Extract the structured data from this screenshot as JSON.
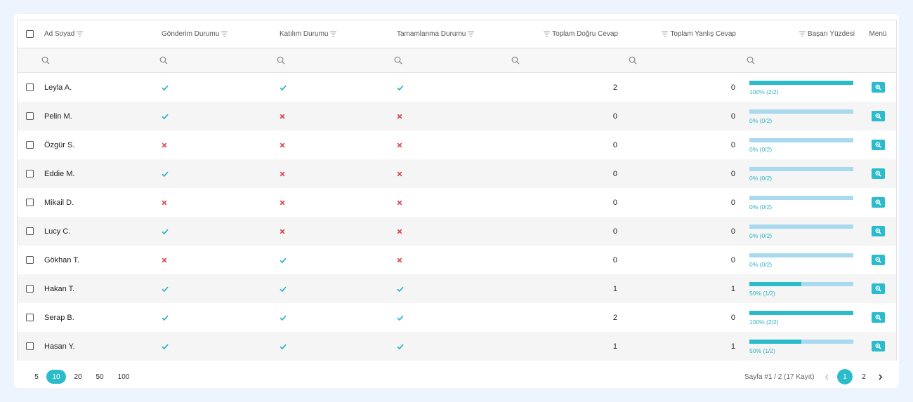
{
  "colors": {
    "accent": "#2bbccb",
    "bar_bg": "#a9d9ef",
    "check": "#2bb3c9",
    "cross": "#d9414b"
  },
  "columns": {
    "name": "Ad Soyad",
    "gonderim": "Gönderim Durumu",
    "katilim": "Katılım Durumu",
    "tamamlanma": "Tamamlanma Durumu",
    "dogru": "Toplam Doğru Cevap",
    "yanlis": "Toplam Yanlış Cevap",
    "basari": "Başarı Yüzdesi",
    "menu": "Menü"
  },
  "rows": [
    {
      "name": "Leyla A.",
      "gonderim": "check",
      "katilim": "check",
      "tamamlanma": "check",
      "dogru": "2",
      "yanlis": "0",
      "basari_pct": 100,
      "basari_txt": "100% (2/2)"
    },
    {
      "name": "Pelin M.",
      "gonderim": "check",
      "katilim": "cross",
      "tamamlanma": "cross",
      "dogru": "0",
      "yanlis": "0",
      "basari_pct": 0,
      "basari_txt": "0% (0/2)"
    },
    {
      "name": "Özgür S.",
      "gonderim": "cross",
      "katilim": "cross",
      "tamamlanma": "cross",
      "dogru": "0",
      "yanlis": "0",
      "basari_pct": 0,
      "basari_txt": "0% (0/2)"
    },
    {
      "name": "Eddie M.",
      "gonderim": "check",
      "katilim": "cross",
      "tamamlanma": "cross",
      "dogru": "0",
      "yanlis": "0",
      "basari_pct": 0,
      "basari_txt": "0% (0/2)"
    },
    {
      "name": "Mikail D.",
      "gonderim": "cross",
      "katilim": "cross",
      "tamamlanma": "cross",
      "dogru": "0",
      "yanlis": "0",
      "basari_pct": 0,
      "basari_txt": "0% (0/2)"
    },
    {
      "name": "Lucy C.",
      "gonderim": "check",
      "katilim": "cross",
      "tamamlanma": "cross",
      "dogru": "0",
      "yanlis": "0",
      "basari_pct": 0,
      "basari_txt": "0% (0/2)"
    },
    {
      "name": "Gökhan T.",
      "gonderim": "cross",
      "katilim": "check",
      "tamamlanma": "cross",
      "dogru": "0",
      "yanlis": "0",
      "basari_pct": 0,
      "basari_txt": "0% (0/2)"
    },
    {
      "name": "Hakan T.",
      "gonderim": "check",
      "katilim": "check",
      "tamamlanma": "check",
      "dogru": "1",
      "yanlis": "1",
      "basari_pct": 50,
      "basari_txt": "50% (1/2)"
    },
    {
      "name": "Serap B.",
      "gonderim": "check",
      "katilim": "check",
      "tamamlanma": "check",
      "dogru": "2",
      "yanlis": "0",
      "basari_pct": 100,
      "basari_txt": "100% (2/2)"
    },
    {
      "name": "Hasan Y.",
      "gonderim": "check",
      "katilim": "check",
      "tamamlanma": "check",
      "dogru": "1",
      "yanlis": "1",
      "basari_pct": 50,
      "basari_txt": "50% (1/2)"
    }
  ],
  "pager": {
    "sizes": [
      "5",
      "10",
      "20",
      "50",
      "100"
    ],
    "active_size": "10",
    "info": "Sayfa #1 / 2 (17 Kayıt)",
    "pages": [
      "1",
      "2"
    ],
    "active_page": "1"
  }
}
